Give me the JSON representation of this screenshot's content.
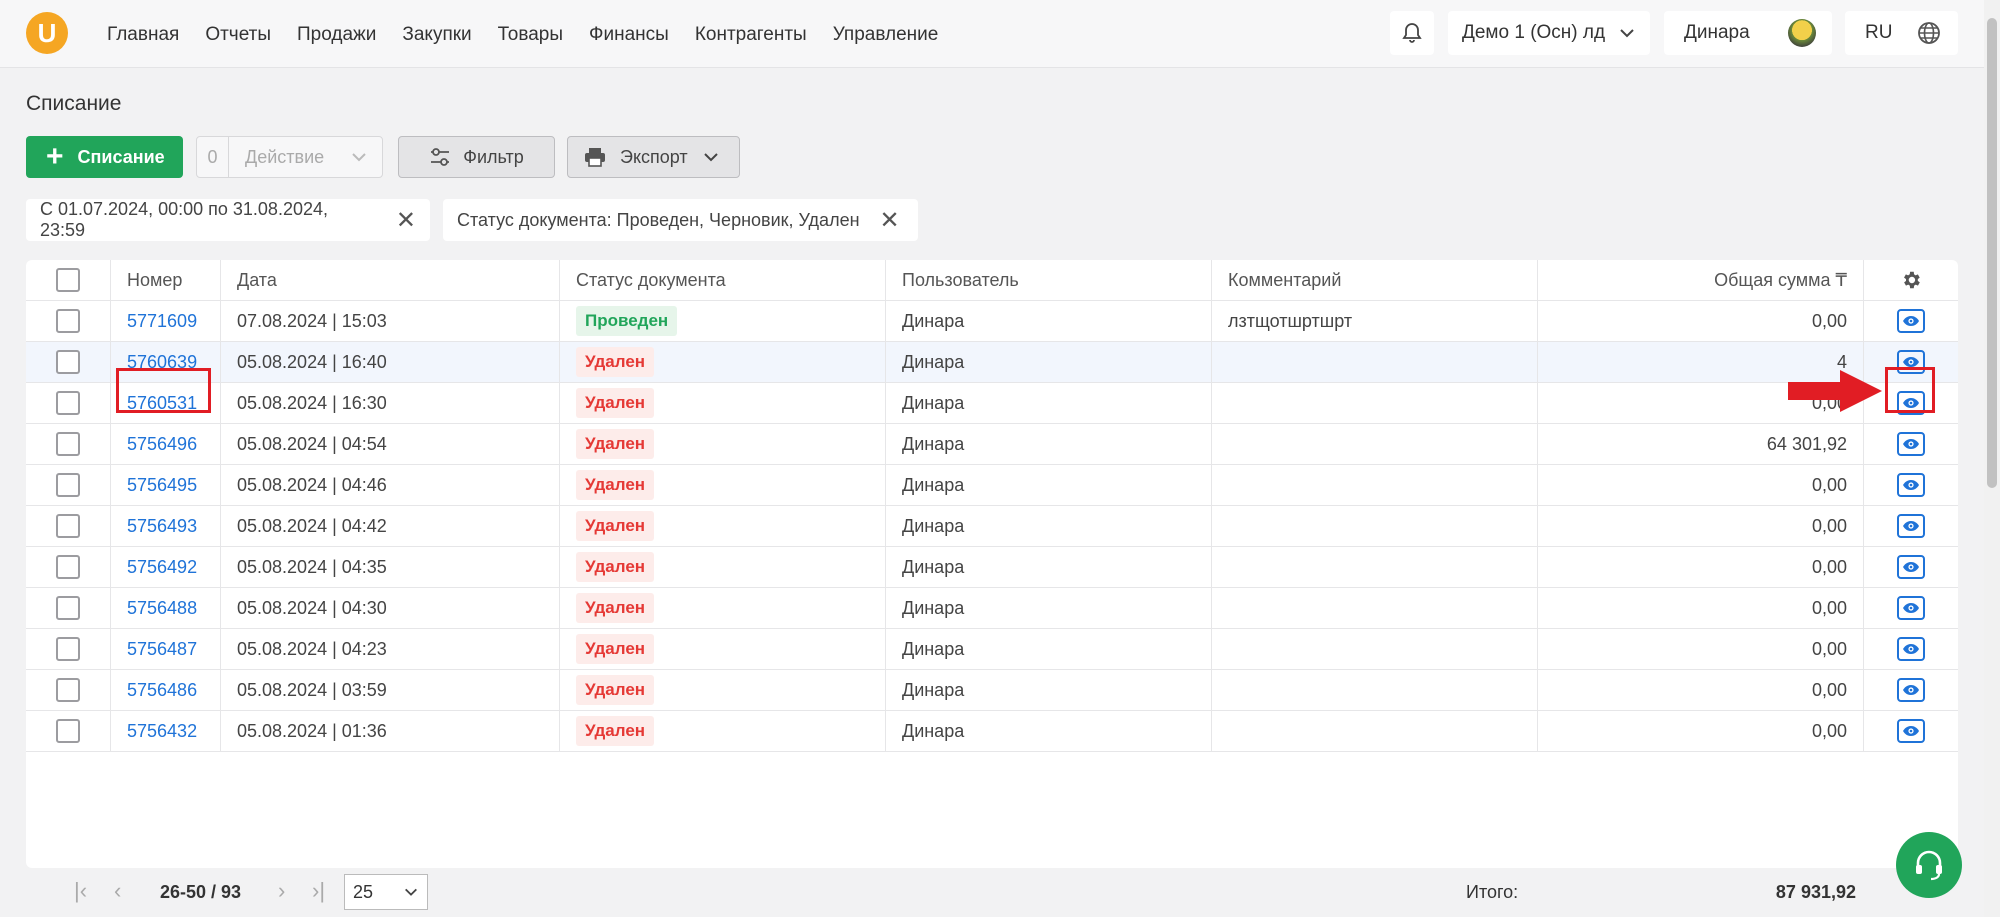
{
  "nav": {
    "logo": "U",
    "items": [
      "Главная",
      "Отчеты",
      "Продажи",
      "Закупки",
      "Товары",
      "Финансы",
      "Контрагенты",
      "Управление"
    ],
    "company": "Демо 1 (Осн) лд",
    "user": "Динара",
    "lang": "RU"
  },
  "page": {
    "title": "Списание"
  },
  "toolbar": {
    "add_label": "Списание",
    "action_count": "0",
    "action_label": "Действие",
    "filter_label": "Фильтр",
    "export_label": "Экспорт"
  },
  "chips": [
    "С 01.07.2024, 00:00 по 31.08.2024, 23:59",
    "Статус документа: Проведен, Черновик, Удален"
  ],
  "table": {
    "headers": {
      "number": "Номер",
      "date": "Дата",
      "status": "Статус документа",
      "user": "Пользователь",
      "comment": "Комментарий",
      "sum": "Общая сумма ₸"
    },
    "rows": [
      {
        "number": "5771609",
        "date": "07.08.2024 | 15:03",
        "status": "Проведен",
        "status_type": "ok",
        "user": "Динара",
        "comment": "лзтщотшртшрт",
        "sum": "0,00"
      },
      {
        "number": "5760639",
        "date": "05.08.2024 | 16:40",
        "status": "Удален",
        "status_type": "del",
        "user": "Динара",
        "comment": "",
        "sum": "4"
      },
      {
        "number": "5760531",
        "date": "05.08.2024 | 16:30",
        "status": "Удален",
        "status_type": "del",
        "user": "Динара",
        "comment": "",
        "sum": "0,00"
      },
      {
        "number": "5756496",
        "date": "05.08.2024 | 04:54",
        "status": "Удален",
        "status_type": "del",
        "user": "Динара",
        "comment": "",
        "sum": "64 301,92"
      },
      {
        "number": "5756495",
        "date": "05.08.2024 | 04:46",
        "status": "Удален",
        "status_type": "del",
        "user": "Динара",
        "comment": "",
        "sum": "0,00"
      },
      {
        "number": "5756493",
        "date": "05.08.2024 | 04:42",
        "status": "Удален",
        "status_type": "del",
        "user": "Динара",
        "comment": "",
        "sum": "0,00"
      },
      {
        "number": "5756492",
        "date": "05.08.2024 | 04:35",
        "status": "Удален",
        "status_type": "del",
        "user": "Динара",
        "comment": "",
        "sum": "0,00"
      },
      {
        "number": "5756488",
        "date": "05.08.2024 | 04:30",
        "status": "Удален",
        "status_type": "del",
        "user": "Динара",
        "comment": "",
        "sum": "0,00"
      },
      {
        "number": "5756487",
        "date": "05.08.2024 | 04:23",
        "status": "Удален",
        "status_type": "del",
        "user": "Динара",
        "comment": "",
        "sum": "0,00"
      },
      {
        "number": "5756486",
        "date": "05.08.2024 | 03:59",
        "status": "Удален",
        "status_type": "del",
        "user": "Динара",
        "comment": "",
        "sum": "0,00"
      },
      {
        "number": "5756432",
        "date": "05.08.2024 | 01:36",
        "status": "Удален",
        "status_type": "del",
        "user": "Динара",
        "comment": "",
        "sum": "0,00"
      }
    ]
  },
  "footer": {
    "range": "26-50 / 93",
    "page_size": "25",
    "total_label": "Итого:",
    "total_value": "87 931,92"
  },
  "colors": {
    "accent": "#21a55a",
    "link": "#1f73d8",
    "danger": "#e53935",
    "highlight": "#e11d24"
  }
}
